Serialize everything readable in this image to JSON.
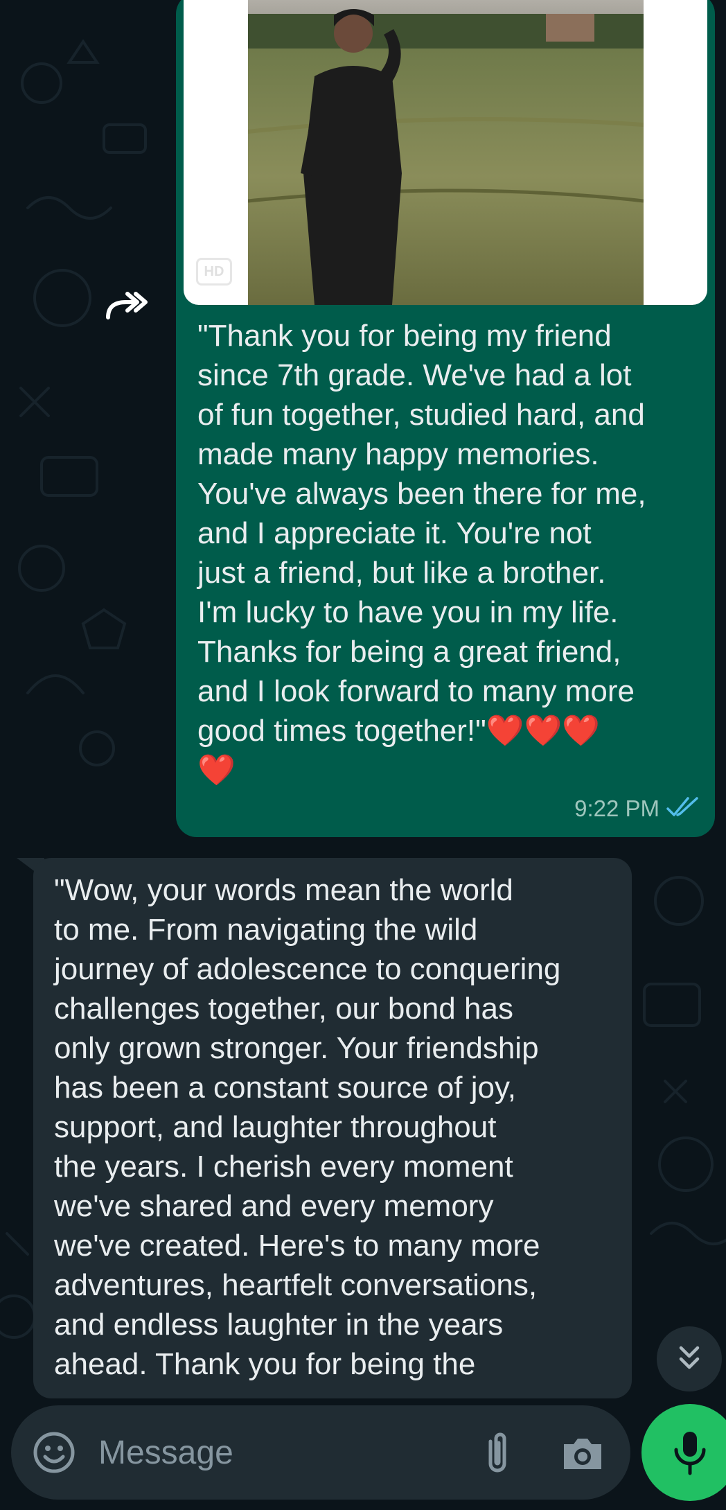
{
  "chat": {
    "outgoing_message": {
      "media": {
        "hd_label": "HD",
        "image_alt": "Photo of a man in a black kurta standing in a grassy field"
      },
      "text": "\"Thank you for being my friend\nsince 7th grade. We've had a lot\nof fun together, studied hard, and\nmade many happy memories.\nYou've always been there for me,\nand I appreciate it. You're not\njust a friend, but like a brother.\nI'm lucky to have you in my life.\nThanks for being a great friend,\nand I look forward to many more\ngood times together!\"❤️❤️❤️\n❤️",
      "time": "9:22 PM",
      "status_icon": "double-check-read-icon"
    },
    "incoming_message": {
      "text": "\"Wow, your words mean the world\nto me. From navigating the wild\njourney of adolescence to conquering\nchallenges together, our bond has\nonly grown stronger. Your friendship\nhas been a constant source of joy,\nsupport, and laughter throughout\nthe years. I cherish every moment\nwe've shared and every memory\nwe've created. Here's to many more\nadventures, heartfelt conversations,\nand endless laughter in the years\nahead. Thank you for being the"
    },
    "forward_icon": "forward-icon",
    "scroll_down_icon": "double-chevron-down-icon"
  },
  "composer": {
    "placeholder": "Message",
    "emoji_icon": "emoji-icon",
    "attach_icon": "paperclip-icon",
    "camera_icon": "camera-icon",
    "mic_icon": "microphone-icon"
  },
  "colors": {
    "background": "#0b141a",
    "outgoing_bubble": "#005c4b",
    "incoming_bubble": "#202c33",
    "accent_green": "#21c063",
    "read_tick": "#53bdeb"
  }
}
